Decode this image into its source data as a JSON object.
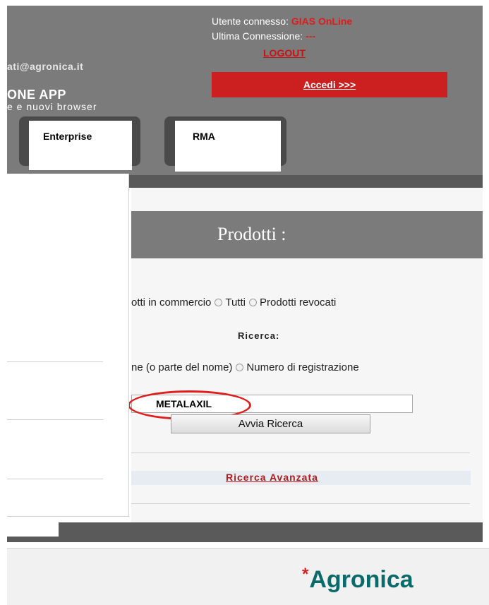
{
  "header": {
    "email_fragment": "ati@agronica.it",
    "app_title": "ONE APP",
    "app_subtitle": "e e nuovi browser",
    "user_label": "Utente connesso: ",
    "user_value": "GIAS OnLine",
    "last_conn_label": "Ultima Connessione: ",
    "last_conn_value": "---",
    "logout": "LOGOUT",
    "accedi": "Accedi >>>"
  },
  "tabs": [
    {
      "label": "Enterprise"
    },
    {
      "label": "RMA"
    }
  ],
  "main": {
    "title": "Prodotti :",
    "filter_options": [
      "otti in commercio",
      "Tutti",
      "Prodotti revocati"
    ],
    "search_label": "Ricerca:",
    "mode_options": [
      "ne (o parte del nome)",
      "Numero di registrazione"
    ],
    "search_value": "METALAXIL",
    "search_button": "Avvia Ricerca",
    "advanced_link": "Ricerca Avanzata"
  },
  "footer": {
    "logo_text": "Agronica",
    "logo_mark": "*"
  },
  "colors": {
    "header_gray": "#7b7b7b",
    "accent_red": "#cc1f1f",
    "logo_teal": "#0b6b6b"
  }
}
